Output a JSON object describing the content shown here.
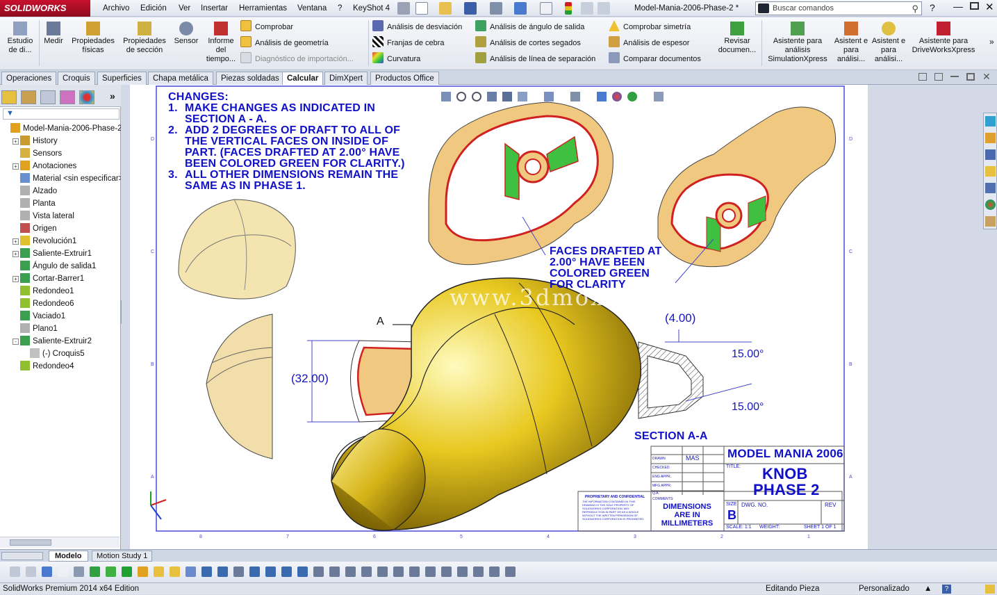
{
  "app": {
    "logo": "SOLIDWORKS",
    "doc_title": "Model-Mania-2006-Phase-2 *"
  },
  "menu": [
    "Archivo",
    "Edición",
    "Ver",
    "Insertar",
    "Herramientas",
    "Ventana",
    "?",
    "KeyShot 4"
  ],
  "search": {
    "placeholder": "Buscar comandos"
  },
  "ribbon": {
    "big_buttons": [
      "Estudio de di...",
      "Medir",
      "Propiedades físicas",
      "Propiedades de sección",
      "Sensor",
      "Informe del tiempo..."
    ],
    "col1": [
      "Comprobar",
      "Análisis de geometría",
      "Diagnóstico de importación..."
    ],
    "col2": [
      "Análisis de desviación",
      "Franjas de cebra",
      "Curvatura"
    ],
    "col3": [
      "Análisis de ángulo de salida",
      "Análisis de cortes segados",
      "Análisis de línea de separación"
    ],
    "col4": [
      "Comprobar simetría",
      "Análisis de espesor",
      "Comparar documentos"
    ],
    "right_buttons": [
      "Revisar documen...",
      "Asistente para análisis SimulationXpress",
      "Asistent e para análisi...",
      "Asistent e para análisi...",
      "Asistente para DriveWorksXpress"
    ]
  },
  "tabs": [
    "Operaciones",
    "Croquis",
    "Superficies",
    "Chapa metálica",
    "Piezas soldadas",
    "Calcular",
    "DimXpert",
    "Productos Office"
  ],
  "active_tab": "Calcular",
  "tree": [
    {
      "label": "Model-Mania-2006-Phase-2",
      "indent": 0,
      "expand": "",
      "icon": "#e0a020"
    },
    {
      "label": "History",
      "indent": 1,
      "expand": "+",
      "icon": "#c89a30"
    },
    {
      "label": "Sensors",
      "indent": 1,
      "expand": "",
      "icon": "#d8b040"
    },
    {
      "label": "Anotaciones",
      "indent": 1,
      "expand": "+",
      "icon": "#e0a020"
    },
    {
      "label": "Material <sin especificar>",
      "indent": 1,
      "expand": "",
      "icon": "#6a8fd0"
    },
    {
      "label": "Alzado",
      "indent": 1,
      "expand": "",
      "icon": "#b0b0b0"
    },
    {
      "label": "Planta",
      "indent": 1,
      "expand": "",
      "icon": "#b0b0b0"
    },
    {
      "label": "Vista lateral",
      "indent": 1,
      "expand": "",
      "icon": "#b0b0b0"
    },
    {
      "label": "Origen",
      "indent": 1,
      "expand": "",
      "icon": "#c05050"
    },
    {
      "label": "Revolución1",
      "indent": 1,
      "expand": "+",
      "icon": "#e0c030"
    },
    {
      "label": "Saliente-Extruir1",
      "indent": 1,
      "expand": "+",
      "icon": "#3aa050"
    },
    {
      "label": "Ángulo de salida1",
      "indent": 1,
      "expand": "",
      "icon": "#3aa050"
    },
    {
      "label": "Cortar-Barrer1",
      "indent": 1,
      "expand": "+",
      "icon": "#3aa050"
    },
    {
      "label": "Redondeo1",
      "indent": 1,
      "expand": "",
      "icon": "#90c030"
    },
    {
      "label": "Redondeo6",
      "indent": 1,
      "expand": "",
      "icon": "#90c030"
    },
    {
      "label": "Vaciado1",
      "indent": 1,
      "expand": "",
      "icon": "#3aa050"
    },
    {
      "label": "Plano1",
      "indent": 1,
      "expand": "",
      "icon": "#b0b0b0"
    },
    {
      "label": "Saliente-Extruir2",
      "indent": 1,
      "expand": "-",
      "icon": "#3aa050"
    },
    {
      "label": "(-) Croquis5",
      "indent": 2,
      "expand": "",
      "icon": "#c0c0c0"
    },
    {
      "label": "Redondeo4",
      "indent": 1,
      "expand": "",
      "icon": "#90c030"
    }
  ],
  "drawing": {
    "changes_title": "CHANGES:",
    "changes": [
      {
        "n": "1.",
        "lines": [
          "MAKE CHANGES AS INDICATED IN",
          "SECTION A - A."
        ]
      },
      {
        "n": "2.",
        "lines": [
          "ADD 2 DEGREES OF DRAFT TO ALL OF",
          "THE VERTICAL FACES ON INSIDE OF",
          "PART.  (FACES DRAFTED AT 2.00° HAVE",
          "BEEN COLORED GREEN FOR CLARITY.)"
        ]
      },
      {
        "n": "3.",
        "lines": [
          "ALL OTHER DIMENSIONS REMAIN THE",
          "SAME AS IN PHASE 1."
        ]
      }
    ],
    "note_faces": [
      "FACES DRAFTED AT",
      "2.00° HAVE BEEN",
      "COLORED GREEN",
      "FOR CLARITY"
    ],
    "dim_32": "(32.00)",
    "dim_4": "(4.00)",
    "dim_15a": "15.00°",
    "dim_15b": "15.00°",
    "section_label": "SECTION A-A",
    "arrow_label": "A",
    "title_block": {
      "company": "MODEL MANIA 2006",
      "title_lbl": "TITLE:",
      "title1": "KNOB",
      "title2": "PHASE 2",
      "size_lbl": "SIZE",
      "size": "B",
      "dwg_lbl": "DWG.  NO.",
      "rev_lbl": "REV",
      "scale": "SCALE: 1:1",
      "weight": "WEIGHT:",
      "sheet": "SHEET 1 OF 1",
      "drawn": "DRAWN",
      "drawn_by": "MAS",
      "checked": "CHECKED",
      "eng": "ENG APPR.",
      "mfg": "MFG APPR.",
      "qa": "Q.A.",
      "comments": "COMMENTS:",
      "dims_note": [
        "DIMENSIONS",
        "ARE IN",
        "MILLIMETERS"
      ],
      "prop_title": "PROPRIETARY AND CONFIDENTIAL",
      "prop_text": "THE INFORMATION CONTAINED IN THIS DRAWING IS THE SOLE PROPERTY OF SOLIDWORKS CORPORATION. ANY REPRODUCTION IN PART OR AS A WHOLE WITHOUT THE WRITTEN PERMISSION OF SOLIDWORKS CORPORATION IS PROHIBITED."
    },
    "border_top": [
      "8",
      "7",
      "6",
      "5",
      "4",
      "3",
      "2",
      "1"
    ],
    "border_side": [
      "D",
      "C",
      "B",
      "A"
    ]
  },
  "watermark": "www.3dmox.",
  "bottom_tabs": [
    "Modelo",
    "Motion Study 1"
  ],
  "status": {
    "app": "SolidWorks Premium 2014 x64 Edition",
    "mode": "Editando Pieza",
    "units": "Personalizado"
  }
}
